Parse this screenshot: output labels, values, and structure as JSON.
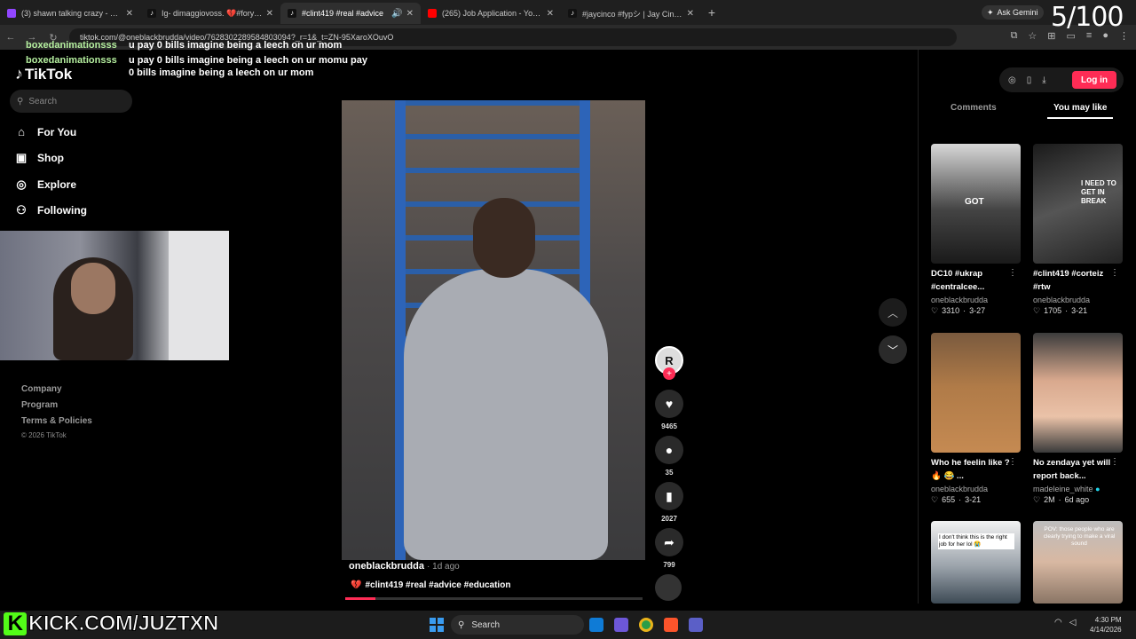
{
  "browser": {
    "tabs": [
      {
        "title": "(3) shawn talking crazy - Twitch",
        "color": "#9146ff"
      },
      {
        "title": "Ig- dimaggiovoss. 💔#foryoup",
        "color": "#222222"
      },
      {
        "title": "#clint419 #real #advice",
        "color": "#222222",
        "active": true
      },
      {
        "title": "(265) Job Application - YouTub",
        "color": "#ff0000"
      },
      {
        "title": "#jaycinco #fypシ | Jay Cinco | Ti",
        "color": "#222222"
      }
    ],
    "new_tab": "+",
    "gemini_label": "Ask Gemini",
    "url": "tiktok.com/@oneblackbrudda/video/7628302289584803094?_r=1&_t=ZN-95XaroXOuvO"
  },
  "overlay": {
    "counter": "5/100",
    "chat": [
      {
        "user": "boxedanimationsss",
        "msg": "u pay 0 bills imagine being a leech on ur mom"
      },
      {
        "user": "boxedanimationsss",
        "msg": "u pay 0 bills imagine being a leech on ur momu pay"
      },
      {
        "user": "",
        "msg": "0 bills imagine being a leech on ur mom"
      }
    ],
    "kick_text": "KICK.COM/JUZTXN",
    "kick_letter": "K"
  },
  "tiktok": {
    "logo": "TikTok",
    "search_placeholder": "Search",
    "nav": [
      {
        "label": "For You",
        "icon": "⌂"
      },
      {
        "label": "Shop",
        "icon": "🛍"
      },
      {
        "label": "Explore",
        "icon": "◎"
      },
      {
        "label": "Following",
        "icon": "👤"
      }
    ],
    "footer": [
      "Company",
      "Program",
      "Terms & Policies"
    ],
    "copyright": "© 2026 TikTok",
    "video": {
      "author": "oneblackbrudda",
      "ago": "· 1d ago",
      "tags": "#clint419 #real #advice #education",
      "tag_emoji": "💔",
      "avatar_letter": "R",
      "progress": 0.1,
      "likes": "9465",
      "comments": "35",
      "saves": "2027",
      "shares": "799"
    },
    "login": "Log in",
    "panel_tabs": [
      "Comments",
      "You may like"
    ],
    "recommendations": [
      {
        "title": "DC10 #ukrap #centralcee...",
        "author": "oneblackbrudda",
        "likes": "3310",
        "date": "3-27",
        "thumb_text": "GOT"
      },
      {
        "title": "#clint419 #corteiz #rtw",
        "author": "oneblackbrudda",
        "likes": "1705",
        "date": "3-21",
        "thumb_text": "I NEED TO GET IN BREAK"
      },
      {
        "title": "Who he feelin like ? 🔥 😂 ...",
        "author": "oneblackbrudda",
        "likes": "655",
        "date": "3-21",
        "thumb_text": ""
      },
      {
        "title": "No zendaya yet will report back...",
        "author": "madeleine_white",
        "likes": "2M",
        "date": "6d ago",
        "thumb_text": ""
      },
      {
        "title": "",
        "author": "",
        "likes": "",
        "date": "",
        "thumb_text": "I don't think this is the right job for her lol 😭"
      },
      {
        "title": "",
        "author": "",
        "likes": "",
        "date": "",
        "thumb_text": "POV: those people who are clearly trying to make a viral sound"
      }
    ]
  },
  "taskbar": {
    "search": "Search",
    "time": "4:30 PM",
    "date": "4/14/2026"
  }
}
